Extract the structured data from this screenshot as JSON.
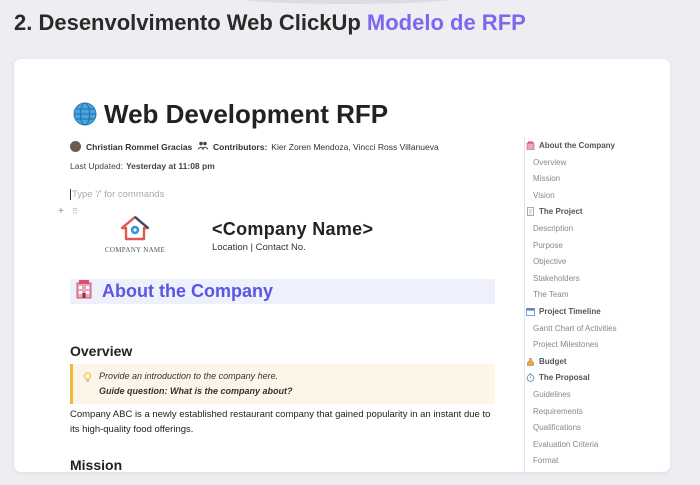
{
  "page": {
    "heading_main": "2. Desenvolvimento Web ClickUp ",
    "heading_accent": "Modelo de RFP"
  },
  "doc": {
    "title": "Web Development RFP",
    "author": "Christian Rommel Gracias",
    "contributors_label": "Contributors:",
    "contributors": "Kier Zoren Mendoza, Vincci Ross Villanueva",
    "updated_label": "Last Updated:",
    "updated_value": "Yesterday at 11:08 pm",
    "command_placeholder": "Type '/' for commands",
    "logo_text": "COMPANY NAME",
    "company_name": "<Company Name>",
    "company_sub": "Location | Contact No.",
    "section_title": "About the Company",
    "overview_heading": "Overview",
    "callout_line1": "Provide an introduction to the company here.",
    "callout_line2": "Guide question: What is the company about?",
    "overview_body": "Company ABC is a newly established restaurant company that gained popularity in an instant due to its high-quality food offerings.",
    "mission_heading": "Mission"
  },
  "toc": {
    "sections": [
      {
        "label": "About the Company",
        "icon": "hotel-icon",
        "items": [
          "Overview",
          "Mission",
          "Vision"
        ]
      },
      {
        "label": "The Project",
        "icon": "document-icon",
        "items": [
          "Description",
          "Purpose",
          "Objective",
          "Stakeholders",
          "The Team"
        ]
      },
      {
        "label": "Project Timeline",
        "icon": "calendar-icon",
        "items": [
          "Gantt Chart of Activities",
          "Project Milestones"
        ]
      },
      {
        "label": "Budget",
        "icon": "money-bag-icon",
        "items": []
      },
      {
        "label": "The Proposal",
        "icon": "stopwatch-icon",
        "items": [
          "Guidelines",
          "Requirements",
          "Qualifications",
          "Evaluation Criteria",
          "Format"
        ]
      }
    ]
  },
  "colors": {
    "accent": "#7b68ee",
    "section_title": "#5b54e6",
    "callout_border": "#f1b93a"
  }
}
